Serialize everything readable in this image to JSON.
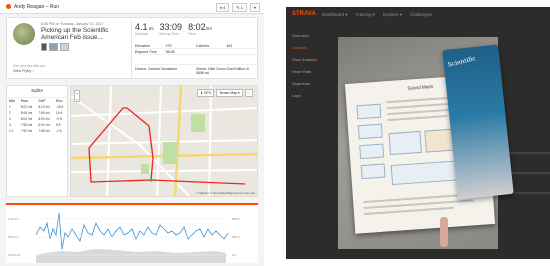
{
  "left_panel": {
    "header": {
      "athlete_activity": "Andy Reagan – Run",
      "actions": [
        "♦ 4",
        "✎ 1",
        "▾"
      ]
    },
    "summary": {
      "meta": "6:56 PM on Tuesday, January 31, 2017",
      "title": "Picking up the Scientific American Feb issue...",
      "flyby_label": "See who ran with you",
      "view_flyby": "View Flyby ›",
      "stats": [
        {
          "value": "4.1",
          "unit": "mi",
          "label": "Distance"
        },
        {
          "value": "33:09",
          "unit": "",
          "label": "Moving Time"
        },
        {
          "value": "8:02",
          "unit": "/mi",
          "label": "Pace"
        }
      ],
      "details": [
        {
          "k1": "Elevation",
          "v1": "279",
          "k2": "Calories",
          "v2": "461"
        },
        {
          "k1": "Elapsed Time",
          "v1": "36:08",
          "k2": "",
          "v2": ""
        }
      ],
      "device": {
        "k": "Device: Garmin Vivoactive",
        "v": "Shoes: Nike Zoom Odd Edition III 0856 mi"
      }
    },
    "splits": {
      "title": "Splits",
      "columns": [
        "Mile",
        "Pace",
        "GAP",
        "Elev"
      ],
      "rows": [
        [
          "1",
          "8:02 /mi",
          "8:13 /mi",
          "-18 ft"
        ],
        [
          "2",
          "8:08 /mi",
          "7:56 /mi",
          "14 ft"
        ],
        [
          "3",
          "8:04 /mi",
          "8:00 /mi",
          "-9 ft"
        ],
        [
          "4",
          "7:58 /mi",
          "8:02 /mi",
          "8 ft"
        ],
        [
          "0.1",
          "7:50 /mi",
          "7:55 /mi",
          "-2 ft"
        ]
      ]
    },
    "map": {
      "tools": [
        "⬇ GPX",
        "Terrain Map ▾",
        "⛶"
      ],
      "zoom": [
        "+",
        "−"
      ],
      "attribution": "© Mapbox © OpenStreetMap Improve this map"
    },
    "chart": {
      "left_labels": [
        "1:00 /mi",
        "8:00 /mi",
        "12:00 /mi"
      ],
      "right_labels": [
        "500 ft",
        "250 ft",
        "0 ft"
      ],
      "accent_color": "#fc4c02"
    }
  },
  "right_panel": {
    "brand": "STRAVA",
    "nav": [
      "Dashboard ▾",
      "Training ▾",
      "Explore ▾",
      "Challenges"
    ],
    "side_items": [
      "Overview",
      "Analysis",
      "Pace Analysis",
      "Heart Rate",
      "Segments",
      "Laps"
    ],
    "magazine_heading": "Sound Mesh",
    "cover_title": "Scientific"
  }
}
